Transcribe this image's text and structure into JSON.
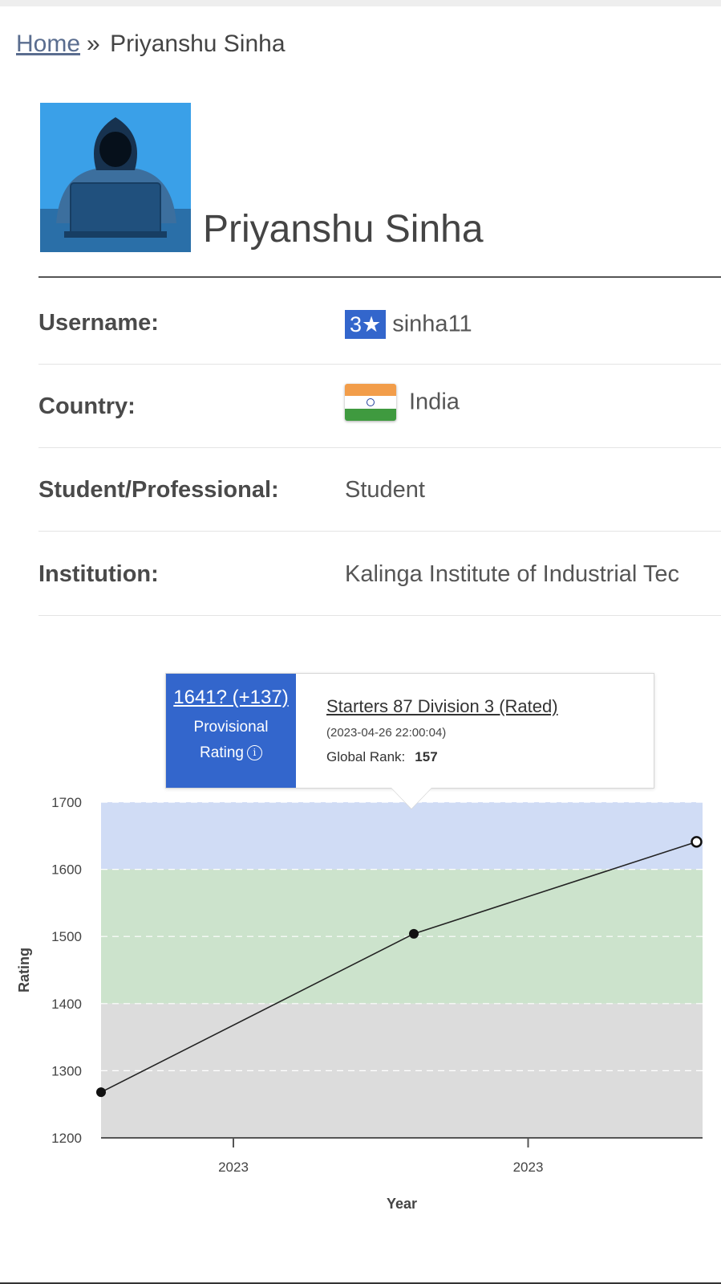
{
  "breadcrumb": {
    "home": "Home",
    "separator": "»",
    "current": "Priyanshu Sinha"
  },
  "profile": {
    "name": "Priyanshu Sinha",
    "avatar_icon": "hooded-hacker-icon",
    "fields": {
      "username": {
        "label": "Username:",
        "stars": "3★",
        "value": "sinha11",
        "badge_color": "#3366cc"
      },
      "country": {
        "label": "Country:",
        "value": "India",
        "flag_icon": "india-flag-icon"
      },
      "student": {
        "label": "Student/Professional:",
        "value": "Student"
      },
      "institution": {
        "label": "Institution:",
        "value": "Kalinga Institute of Industrial Tec"
      }
    }
  },
  "tooltip": {
    "rating": "1641? (+137)",
    "provisional": "Provisional",
    "rating_label": "Rating",
    "info_icon": "info-circle-icon",
    "contest": "Starters 87 Division 3 (Rated)",
    "date": "(2023-04-26 22:00:04)",
    "rank_label": "Global Rank:",
    "rank_value": "157",
    "accent": "#3366cc"
  },
  "chart_data": {
    "type": "line",
    "title": "",
    "xlabel": "Year",
    "ylabel": "Rating",
    "ylim": [
      1200,
      1700
    ],
    "yticks": [
      1200,
      1300,
      1400,
      1500,
      1600,
      1700
    ],
    "x_tick_labels": [
      "2023",
      "2023"
    ],
    "x_tick_fractions": [
      0.22,
      0.71
    ],
    "bands": [
      {
        "from": 1200,
        "to": 1400,
        "color": "#dcdcdc"
      },
      {
        "from": 1400,
        "to": 1600,
        "color": "#cce3cc"
      },
      {
        "from": 1600,
        "to": 1700,
        "color": "#d0dcf5"
      }
    ],
    "grid": true,
    "points": [
      {
        "x_fraction": 0.0,
        "rating": 1268,
        "hollow": false
      },
      {
        "x_fraction": 0.52,
        "rating": 1504,
        "hollow": false
      },
      {
        "x_fraction": 0.99,
        "rating": 1641,
        "hollow": true
      }
    ],
    "line_color": "#222222"
  }
}
